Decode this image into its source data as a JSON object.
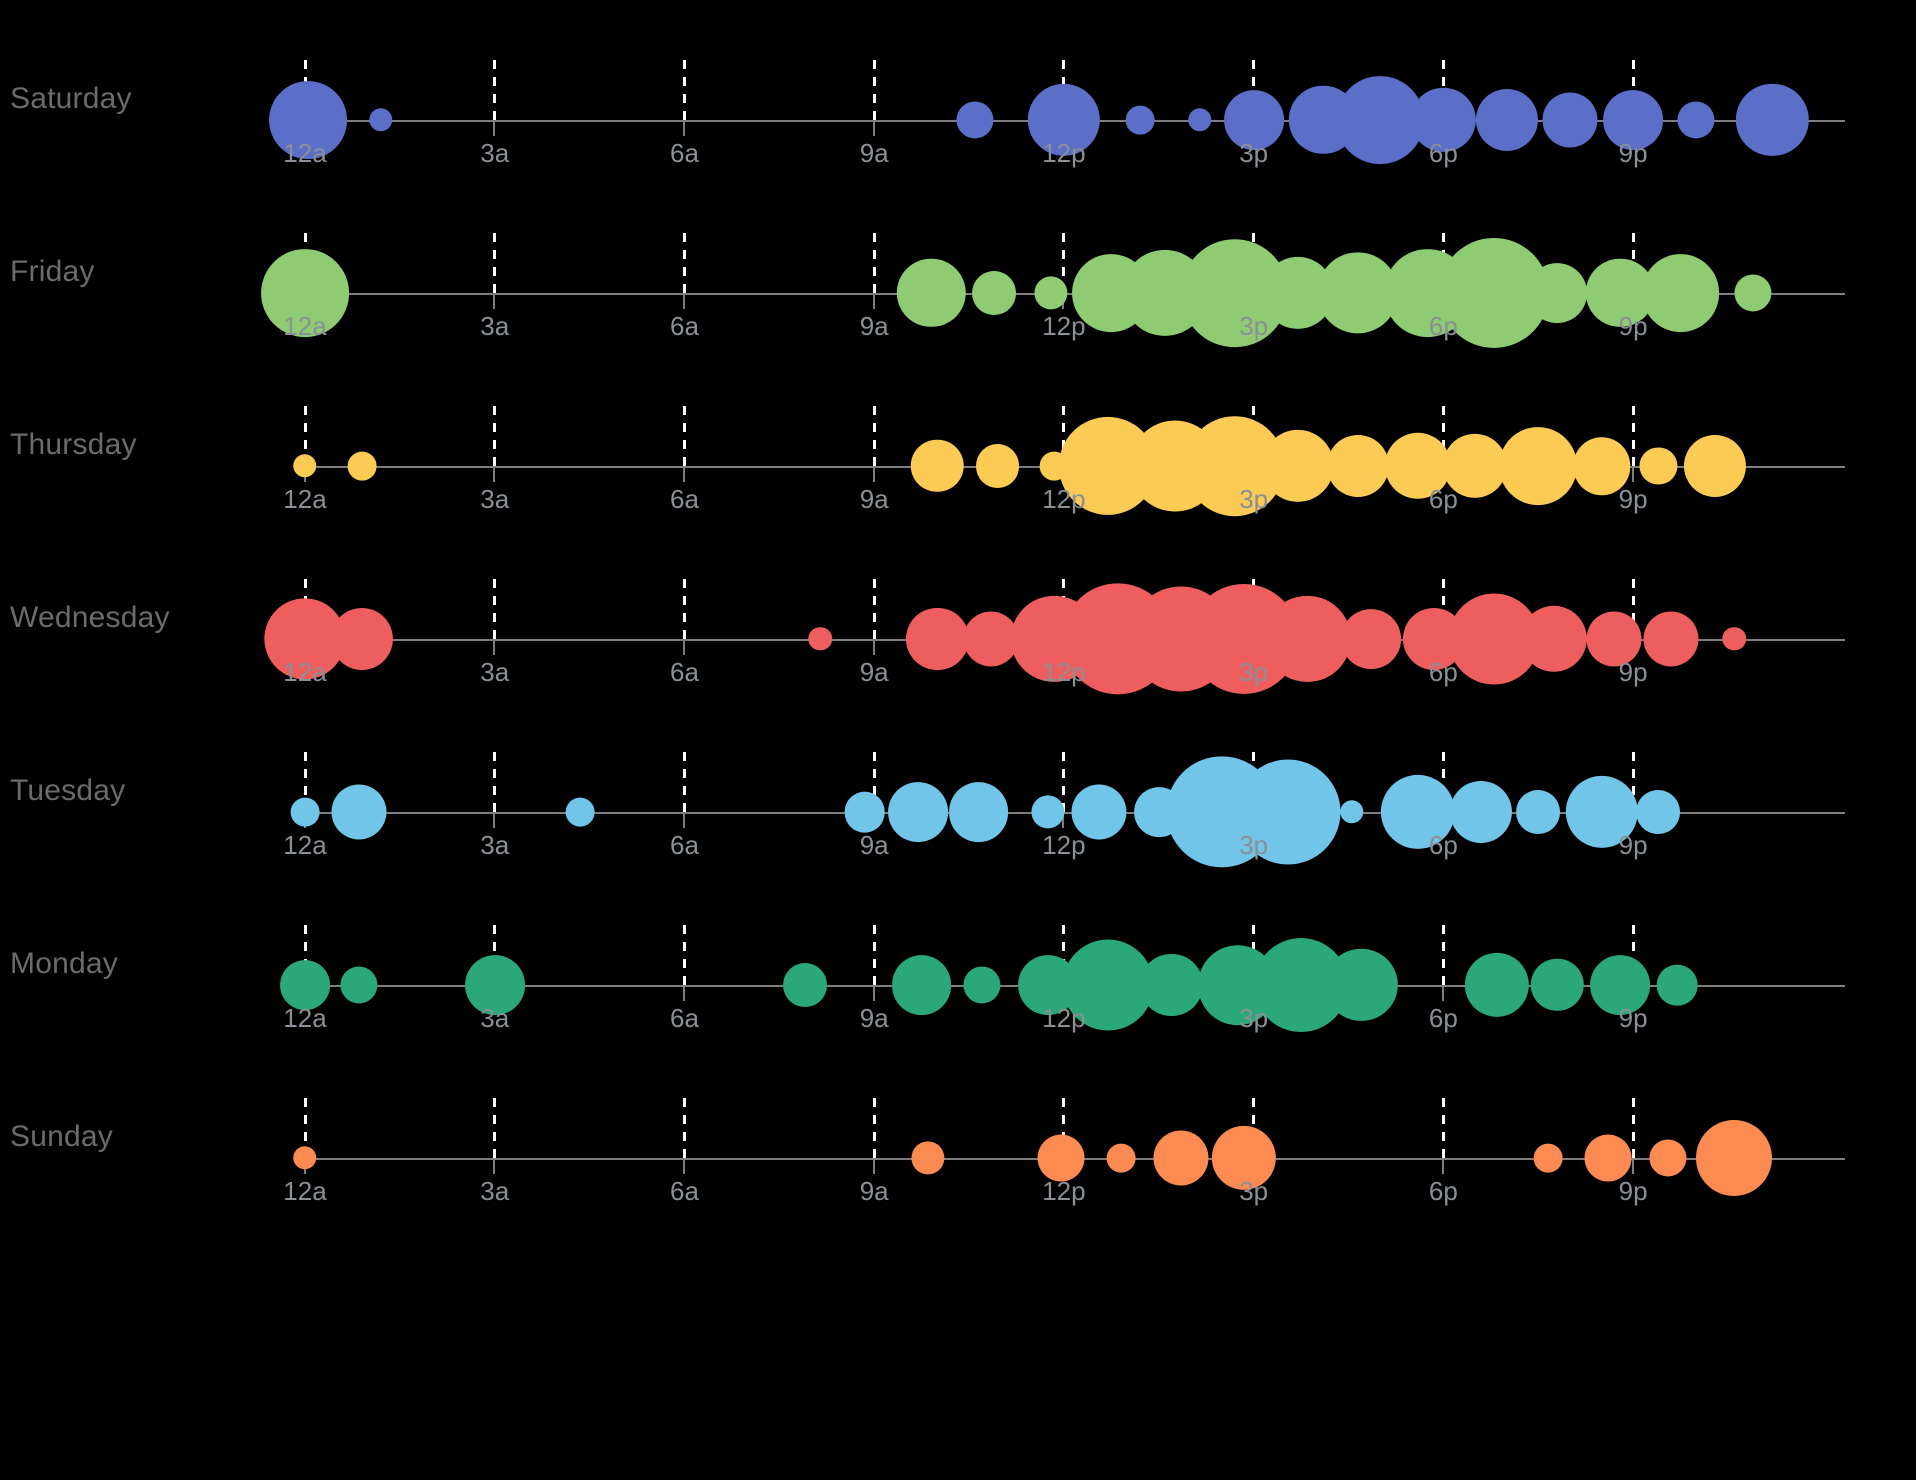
{
  "chart_data": {
    "type": "scatter",
    "title": "",
    "subtitle": "",
    "xlabel": "",
    "ylabel": "",
    "description": "Punchcard bubble chart of activity by hour of day for each day of the week. Bubble area encodes activity count.",
    "xlim": [
      0,
      24
    ],
    "grid": true,
    "legend_position": "none",
    "background_color": "#000000",
    "axis_line_color": "#7d7d7d",
    "gridline_color": "#ffffff",
    "tick_label_color": "#8a9096",
    "day_label_color": "#6b6b6b",
    "tick_hours": [
      0,
      3,
      6,
      9,
      12,
      15,
      18,
      21
    ],
    "tick_labels": [
      "12a",
      "3a",
      "6a",
      "9a",
      "12p",
      "3p",
      "6p",
      "9p"
    ],
    "series": [
      {
        "name": "Saturday",
        "color": "#5b6fc9",
        "points": [
          {
            "hour": 0.05,
            "value": 22
          },
          {
            "hour": 1.2,
            "value": 2
          },
          {
            "hour": 10.6,
            "value": 5
          },
          {
            "hour": 12.0,
            "value": 19
          },
          {
            "hour": 13.2,
            "value": 3
          },
          {
            "hour": 14.15,
            "value": 2
          },
          {
            "hour": 15.0,
            "value": 13
          },
          {
            "hour": 16.1,
            "value": 17
          },
          {
            "hour": 17.0,
            "value": 28
          },
          {
            "hour": 18.0,
            "value": 15
          },
          {
            "hour": 19.0,
            "value": 14
          },
          {
            "hour": 20.0,
            "value": 11
          },
          {
            "hour": 21.0,
            "value": 13
          },
          {
            "hour": 22.0,
            "value": 5
          },
          {
            "hour": 23.2,
            "value": 19
          }
        ]
      },
      {
        "name": "Friday",
        "color": "#8ecb73",
        "points": [
          {
            "hour": 0.0,
            "value": 28
          },
          {
            "hour": 9.9,
            "value": 17
          },
          {
            "hour": 10.9,
            "value": 7
          },
          {
            "hour": 11.8,
            "value": 4
          },
          {
            "hour": 12.75,
            "value": 22
          },
          {
            "hour": 13.6,
            "value": 27
          },
          {
            "hour": 14.7,
            "value": 42
          },
          {
            "hour": 15.7,
            "value": 19
          },
          {
            "hour": 16.65,
            "value": 24
          },
          {
            "hour": 17.75,
            "value": 28
          },
          {
            "hour": 18.8,
            "value": 44
          },
          {
            "hour": 19.8,
            "value": 13
          },
          {
            "hour": 20.8,
            "value": 17
          },
          {
            "hour": 21.75,
            "value": 22
          },
          {
            "hour": 22.9,
            "value": 5
          }
        ]
      },
      {
        "name": "Thursday",
        "color": "#fbcb53",
        "points": [
          {
            "hour": 0.0,
            "value": 2
          },
          {
            "hour": 0.9,
            "value": 3
          },
          {
            "hour": 10.0,
            "value": 10
          },
          {
            "hour": 10.95,
            "value": 7
          },
          {
            "hour": 11.85,
            "value": 3
          },
          {
            "hour": 12.7,
            "value": 35
          },
          {
            "hour": 13.75,
            "value": 30
          },
          {
            "hour": 14.7,
            "value": 36
          },
          {
            "hour": 15.7,
            "value": 19
          },
          {
            "hour": 16.65,
            "value": 14
          },
          {
            "hour": 17.6,
            "value": 16
          },
          {
            "hour": 18.5,
            "value": 15
          },
          {
            "hour": 19.5,
            "value": 22
          },
          {
            "hour": 20.5,
            "value": 12
          },
          {
            "hour": 21.4,
            "value": 5
          },
          {
            "hour": 22.3,
            "value": 14
          }
        ]
      },
      {
        "name": "Wednesday",
        "color": "#ef5e5e",
        "points": [
          {
            "hour": 0.0,
            "value": 24
          },
          {
            "hour": 0.9,
            "value": 14
          },
          {
            "hour": 8.15,
            "value": 2
          },
          {
            "hour": 10.0,
            "value": 14
          },
          {
            "hour": 10.85,
            "value": 11
          },
          {
            "hour": 11.85,
            "value": 27
          },
          {
            "hour": 12.85,
            "value": 45
          },
          {
            "hour": 13.85,
            "value": 40
          },
          {
            "hour": 14.85,
            "value": 44
          },
          {
            "hour": 15.85,
            "value": 27
          },
          {
            "hour": 16.85,
            "value": 13
          },
          {
            "hour": 17.85,
            "value": 14
          },
          {
            "hour": 18.8,
            "value": 30
          },
          {
            "hour": 19.75,
            "value": 16
          },
          {
            "hour": 20.7,
            "value": 11
          },
          {
            "hour": 21.6,
            "value": 11
          },
          {
            "hour": 22.6,
            "value": 2
          }
        ]
      },
      {
        "name": "Tuesday",
        "color": "#71c5e8",
        "points": [
          {
            "hour": 0.0,
            "value": 3
          },
          {
            "hour": 0.85,
            "value": 11
          },
          {
            "hour": 4.35,
            "value": 3
          },
          {
            "hour": 8.85,
            "value": 6
          },
          {
            "hour": 9.7,
            "value": 13
          },
          {
            "hour": 10.65,
            "value": 13
          },
          {
            "hour": 11.75,
            "value": 4
          },
          {
            "hour": 12.55,
            "value": 11
          },
          {
            "hour": 13.5,
            "value": 9
          },
          {
            "hour": 14.5,
            "value": 45
          },
          {
            "hour": 15.55,
            "value": 40
          },
          {
            "hour": 16.55,
            "value": 2
          },
          {
            "hour": 17.6,
            "value": 20
          },
          {
            "hour": 18.6,
            "value": 14
          },
          {
            "hour": 19.5,
            "value": 7
          },
          {
            "hour": 20.5,
            "value": 19
          },
          {
            "hour": 21.4,
            "value": 7
          }
        ]
      },
      {
        "name": "Monday",
        "color": "#2aa87a",
        "points": [
          {
            "hour": 0.0,
            "value": 9
          },
          {
            "hour": 0.85,
            "value": 5
          },
          {
            "hour": 3.0,
            "value": 13
          },
          {
            "hour": 7.9,
            "value": 7
          },
          {
            "hour": 9.75,
            "value": 13
          },
          {
            "hour": 10.7,
            "value": 5
          },
          {
            "hour": 11.75,
            "value": 13
          },
          {
            "hour": 12.7,
            "value": 30
          },
          {
            "hour": 13.7,
            "value": 14
          },
          {
            "hour": 14.75,
            "value": 23
          },
          {
            "hour": 15.75,
            "value": 32
          },
          {
            "hour": 16.7,
            "value": 19
          },
          {
            "hour": 18.85,
            "value": 15
          },
          {
            "hour": 19.8,
            "value": 10
          },
          {
            "hour": 20.8,
            "value": 13
          },
          {
            "hour": 21.7,
            "value": 6
          }
        ]
      },
      {
        "name": "Sunday",
        "color": "#fb8b50",
        "points": [
          {
            "hour": 0.0,
            "value": 2
          },
          {
            "hour": 9.85,
            "value": 4
          },
          {
            "hour": 11.95,
            "value": 8
          },
          {
            "hour": 12.9,
            "value": 3
          },
          {
            "hour": 13.85,
            "value": 11
          },
          {
            "hour": 14.85,
            "value": 15
          },
          {
            "hour": 19.65,
            "value": 3
          },
          {
            "hour": 20.6,
            "value": 8
          },
          {
            "hour": 21.55,
            "value": 5
          },
          {
            "hour": 22.6,
            "value": 21
          }
        ]
      }
    ]
  }
}
